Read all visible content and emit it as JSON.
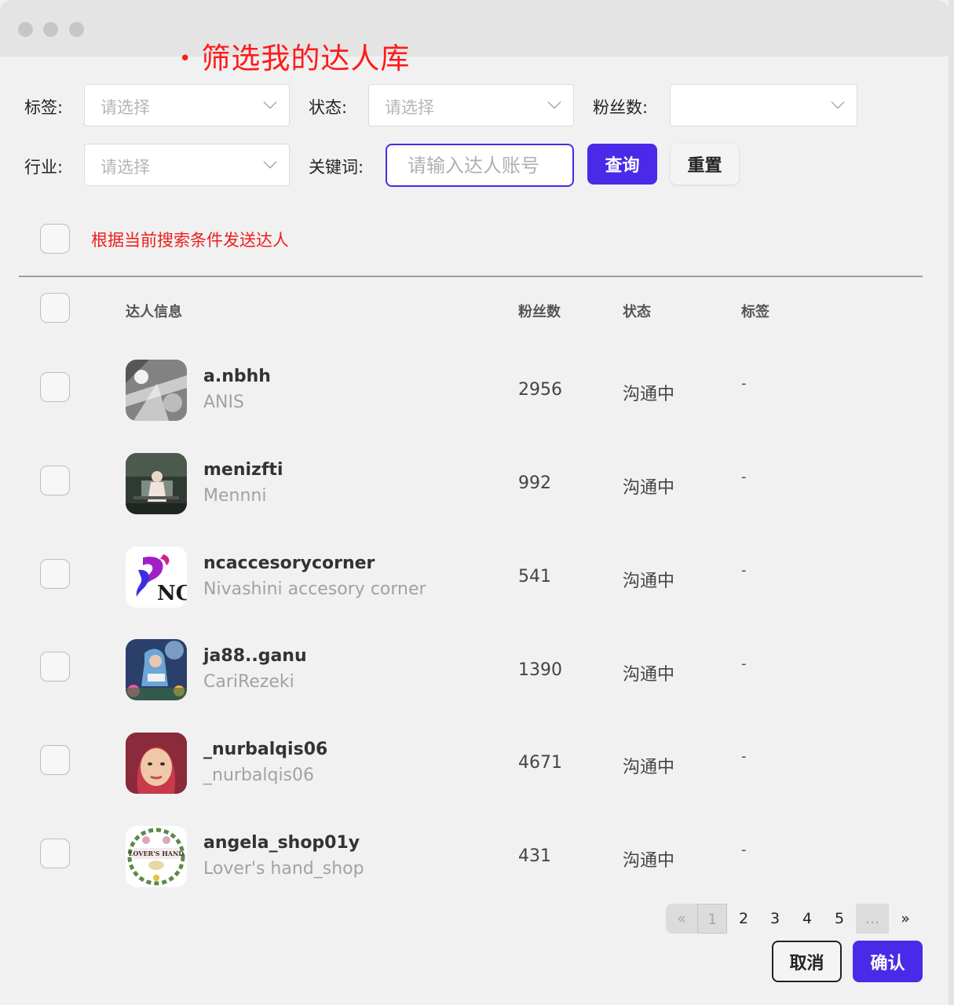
{
  "annotation_title": "筛选我的达人库",
  "filters": {
    "tag_label": "标签:",
    "tag_placeholder": "请选择",
    "status_label": "状态:",
    "status_placeholder": "请选择",
    "fans_label": "粉丝数:",
    "fans_value": "",
    "industry_label": "行业:",
    "industry_placeholder": "请选择",
    "keyword_label": "关键词:",
    "keyword_placeholder": "请输入达人账号",
    "query_button": "查询",
    "reset_button": "重置"
  },
  "send_by_condition_label": "根据当前搜索条件发送达人",
  "table": {
    "headers": [
      "达人信息",
      "粉丝数",
      "状态",
      "标签"
    ],
    "rows": [
      {
        "username": "a.nbhh",
        "nickname": "ANIS",
        "fans": "2956",
        "status": "沟通中",
        "tag": "-"
      },
      {
        "username": "menizfti",
        "nickname": "Mennni",
        "fans": "992",
        "status": "沟通中",
        "tag": "-"
      },
      {
        "username": "ncaccesorycorner",
        "nickname": "Nivashini accesory corner",
        "fans": "541",
        "status": "沟通中",
        "tag": "-"
      },
      {
        "username": "ja88..ganu",
        "nickname": "CariRezeki",
        "fans": "1390",
        "status": "沟通中",
        "tag": "-"
      },
      {
        "username": "_nurbalqis06",
        "nickname": "_nurbalqis06",
        "fans": "4671",
        "status": "沟通中",
        "tag": "-"
      },
      {
        "username": "angela_shop01y",
        "nickname": "Lover's hand_shop",
        "fans": "431",
        "status": "沟通中",
        "tag": "-"
      }
    ]
  },
  "pagination": {
    "prev": "«",
    "pages": [
      "1",
      "2",
      "3",
      "4",
      "5"
    ],
    "current": "1",
    "ellipsis": "...",
    "next": "»"
  },
  "footer": {
    "cancel_button": "取消",
    "confirm_button": "确认"
  },
  "colors": {
    "accent": "#4a2ae8",
    "annotation_red": "#ff1a1a"
  }
}
